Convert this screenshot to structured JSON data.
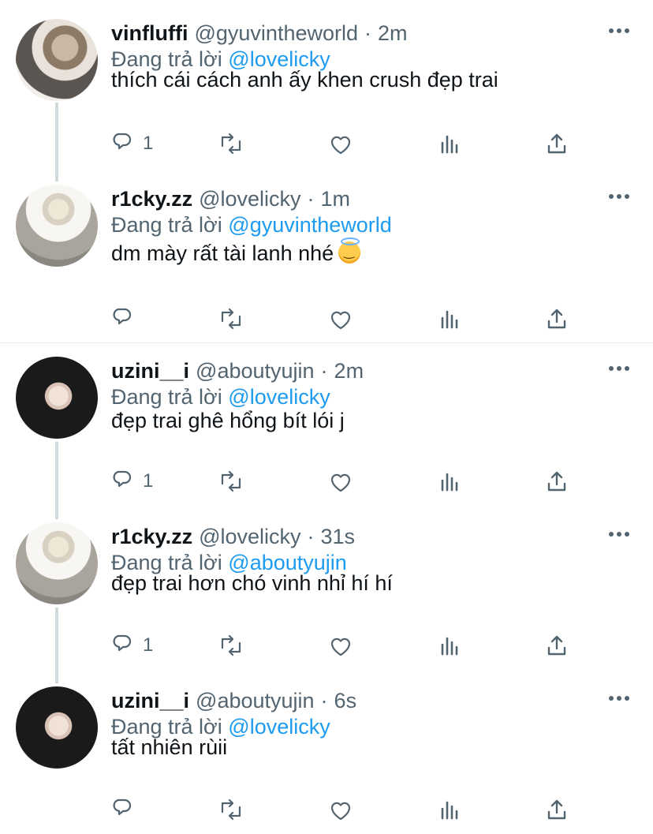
{
  "tweets": [
    {
      "name": "vinfluffi",
      "handle": "@gyuvintheworld",
      "time": "2m",
      "reply_label": "Đang trả lời",
      "reply_to": "@lovelicky",
      "text": "thích cái cách anh ấy khen crush đẹp trai",
      "reply_count": "1",
      "avatar": "dog-photo-avatar"
    },
    {
      "name": "r1cky.zz",
      "handle": "@lovelicky",
      "time": "1m",
      "reply_label": "Đang trả lời",
      "reply_to": "@gyuvintheworld",
      "text": "dm mày rất tài lanh nhé",
      "emoji": "smiling-face-with-halo",
      "reply_count": "",
      "avatar": "blond-photo-avatar"
    },
    {
      "name": "uzini__i",
      "handle": "@aboutyujin",
      "time": "2m",
      "reply_label": "Đang trả lời",
      "reply_to": "@lovelicky",
      "text": "đẹp trai ghê hổng bít lói j",
      "reply_count": "1",
      "avatar": "dark-hair-photo-avatar"
    },
    {
      "name": "r1cky.zz",
      "handle": "@lovelicky",
      "time": "31s",
      "reply_label": "Đang trả lời",
      "reply_to": "@aboutyujin",
      "text": "đẹp trai hơn chó vinh nhỉ hí hí",
      "reply_count": "1",
      "avatar": "blond-photo-avatar"
    },
    {
      "name": "uzini__i",
      "handle": "@aboutyujin",
      "time": "6s",
      "reply_label": "Đang trả lời",
      "reply_to": "@lovelicky",
      "text": "tất nhiên rùii",
      "reply_count": "",
      "avatar": "dark-hair-photo-avatar"
    }
  ],
  "icons": {
    "reply": "reply-icon",
    "retweet": "retweet-icon",
    "like": "heart-icon",
    "views": "analytics-icon",
    "share": "share-icon",
    "more": "more-icon"
  },
  "colors": {
    "text": "#0f1419",
    "secondary": "#536471",
    "link": "#1d9bf0",
    "thread_line": "#cfd9de"
  }
}
